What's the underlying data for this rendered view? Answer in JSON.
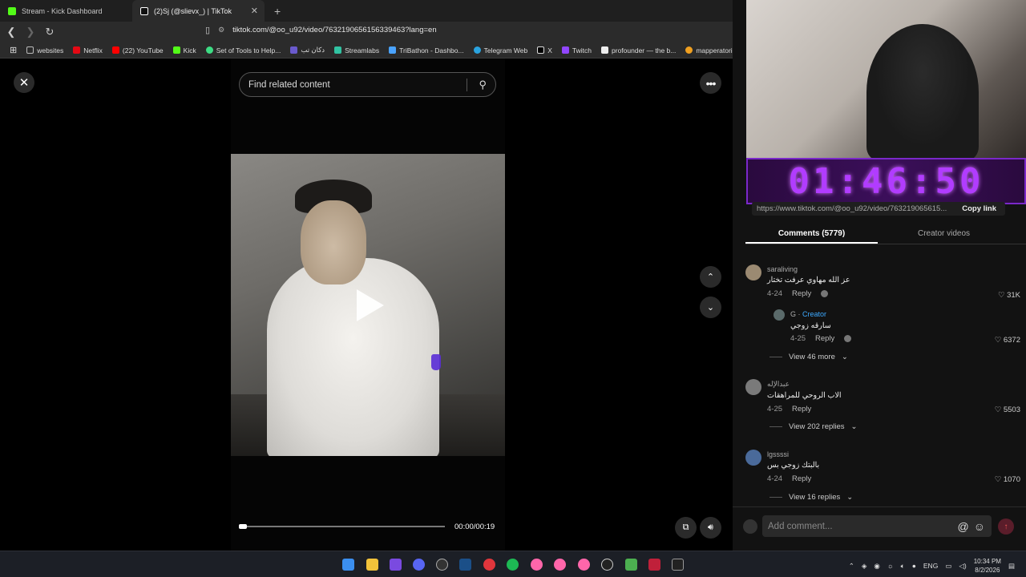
{
  "browser": {
    "tabs": [
      {
        "label": "Stream - Kick Dashboard",
        "favicon_color": "#53fc18"
      },
      {
        "label": "(2)Sj (@slievx_) | TikTok",
        "favicon_color": "#ffffff"
      }
    ],
    "new_tab": "+",
    "url": "tiktok.com/@oo_u92/video/7632190656156339463?lang=en",
    "bookmarks": [
      {
        "label": "websites",
        "color": "#bbbbbb"
      },
      {
        "label": "Netflix",
        "color": "#e50914"
      },
      {
        "label": "(22) YouTube",
        "color": "#ff0000"
      },
      {
        "label": "Kick",
        "color": "#53fc18"
      },
      {
        "label": "Set of Tools to Help...",
        "color": "#3ddc84"
      },
      {
        "label": "دكان تب",
        "color": "#6a5acd"
      },
      {
        "label": "Streamlabs",
        "color": "#31c3a2"
      },
      {
        "label": "TriBathon - Dashbo...",
        "color": "#4aa3ff"
      },
      {
        "label": "Telegram Web",
        "color": "#2aa3df"
      },
      {
        "label": "X",
        "color": "#dddddd"
      },
      {
        "label": "Twitch",
        "color": "#9146ff"
      },
      {
        "label": "profounder — the b...",
        "color": "#eeeeee"
      },
      {
        "label": "mapperatorinator_i...",
        "color": "#f0a020"
      }
    ]
  },
  "player": {
    "search_placeholder": "Find related content",
    "time": "00:00/00:19",
    "progress": 0.0
  },
  "overlay": {
    "timer": "01:46:50",
    "link": "https://www.tiktok.com/@oo_u92/video/763219065615...",
    "copy_link": "Copy link"
  },
  "comments_panel": {
    "tabs": [
      "Comments (5779)",
      "Creator videos"
    ],
    "comments": [
      {
        "user": "saraliving",
        "text": "عز الله مهاوي عرفت تختار",
        "date": "4-24",
        "reply": "Reply",
        "likes": "31K"
      },
      {
        "user": "G · ",
        "creator": "Creator",
        "text": "سارقه زوجي",
        "date": "4-25",
        "reply": "Reply",
        "likes": "6372"
      },
      {
        "view_more": "View 46 more"
      },
      {
        "user": "عبدالإله",
        "text": "الاب الروحي للمراهقات",
        "date": "4-25",
        "reply": "Reply",
        "likes": "5503"
      },
      {
        "view_more": "View 202 replies"
      },
      {
        "user": "lgssssi",
        "text": "بالبتك زوجي بس",
        "date": "4-24",
        "reply": "Reply",
        "likes": "1070"
      },
      {
        "view_more": "View 16 replies"
      }
    ],
    "add_placeholder": "Add comment..."
  },
  "taskbar": {
    "lang": "ENG",
    "time": "10:34 PM",
    "date": "8/2/2026"
  }
}
